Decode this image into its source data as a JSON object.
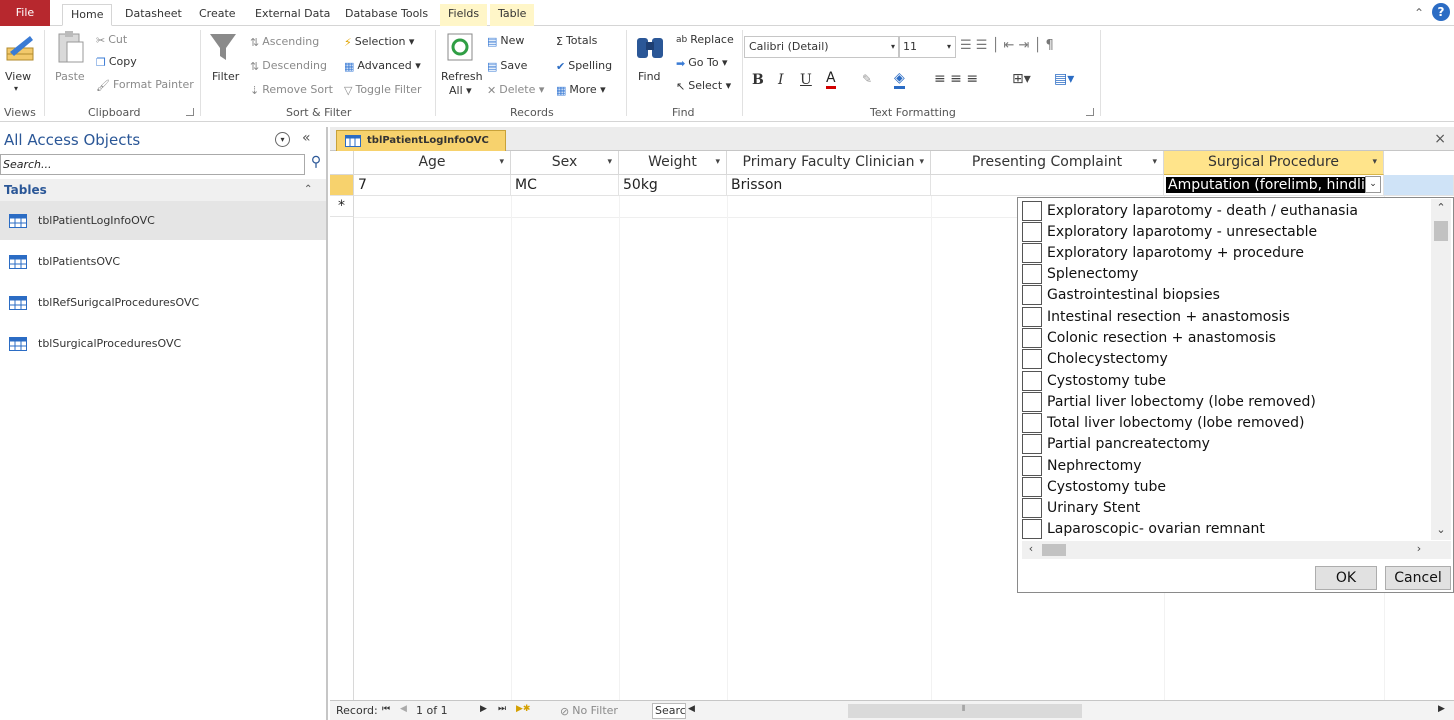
{
  "ribbon_tabs": [
    "File",
    "Home",
    "Datasheet",
    "Create",
    "External Data",
    "Database Tools",
    "Fields",
    "Table"
  ],
  "ribbon": {
    "views": {
      "label": "Views",
      "view": "View"
    },
    "clipboard": {
      "label": "Clipboard",
      "paste": "Paste",
      "cut": "Cut",
      "copy": "Copy",
      "format_painter": "Format Painter"
    },
    "sort_filter": {
      "label": "Sort & Filter",
      "filter": "Filter",
      "ascending": "Ascending",
      "descending": "Descending",
      "remove_sort": "Remove Sort",
      "selection": "Selection ▾",
      "advanced": "Advanced ▾",
      "toggle_filter": "Toggle Filter"
    },
    "records": {
      "label": "Records",
      "refresh": "Refresh",
      "refresh_all": "All ▾",
      "new": "New",
      "save": "Save",
      "delete": "Delete ▾",
      "totals": "Totals",
      "spelling": "Spelling",
      "more": "More ▾"
    },
    "find": {
      "label": "Find",
      "find": "Find",
      "replace": "Replace",
      "goto": "Go To ▾",
      "select": "Select ▾"
    },
    "text_formatting": {
      "label": "Text Formatting",
      "font": "Calibri (Detail)",
      "size": "11",
      "bold": "B",
      "italic": "I",
      "underline": "U"
    }
  },
  "nav": {
    "title": "All Access Objects",
    "search_placeholder": "Search...",
    "group": "Tables",
    "items": [
      "tblPatientLogInfoOVC",
      "tblPatientsOVC",
      "tblRefSurigcalProceduresOVC",
      "tblSurgicalProceduresOVC"
    ]
  },
  "doc_tab": "tblPatientLogInfoOVC",
  "columns": [
    "Age",
    "Sex",
    "Weight",
    "Primary Faculty Clinician",
    "Presenting Complaint",
    "Surgical Procedure"
  ],
  "row": {
    "age": "7",
    "sex": "MC",
    "weight": "50kg",
    "clinician": "Brisson",
    "complaint": "",
    "procedure": "Amputation (forelimb, hindli"
  },
  "new_row_marker": "*",
  "dropdown": {
    "items": [
      "Exploratory laparotomy - death / euthanasia",
      "Exploratory laparotomy - unresectable",
      "Exploratory laparotomy + procedure",
      "Splenectomy",
      "Gastrointestinal biopsies",
      "Intestinal resection + anastomosis",
      "Colonic resection + anastomosis",
      "Cholecystectomy",
      "Cystostomy tube",
      "Partial liver lobectomy  (lobe removed)",
      "Total liver lobectomy (lobe removed)",
      "Partial pancreatectomy",
      "Nephrectomy",
      "Cystostomy tube",
      "Urinary Stent",
      "Laparoscopic- ovarian remnant"
    ],
    "ok": "OK",
    "cancel": "Cancel"
  },
  "record_nav": {
    "label": "Record:",
    "position": "1 of 1",
    "filter": "No Filter",
    "search": "Searc"
  }
}
